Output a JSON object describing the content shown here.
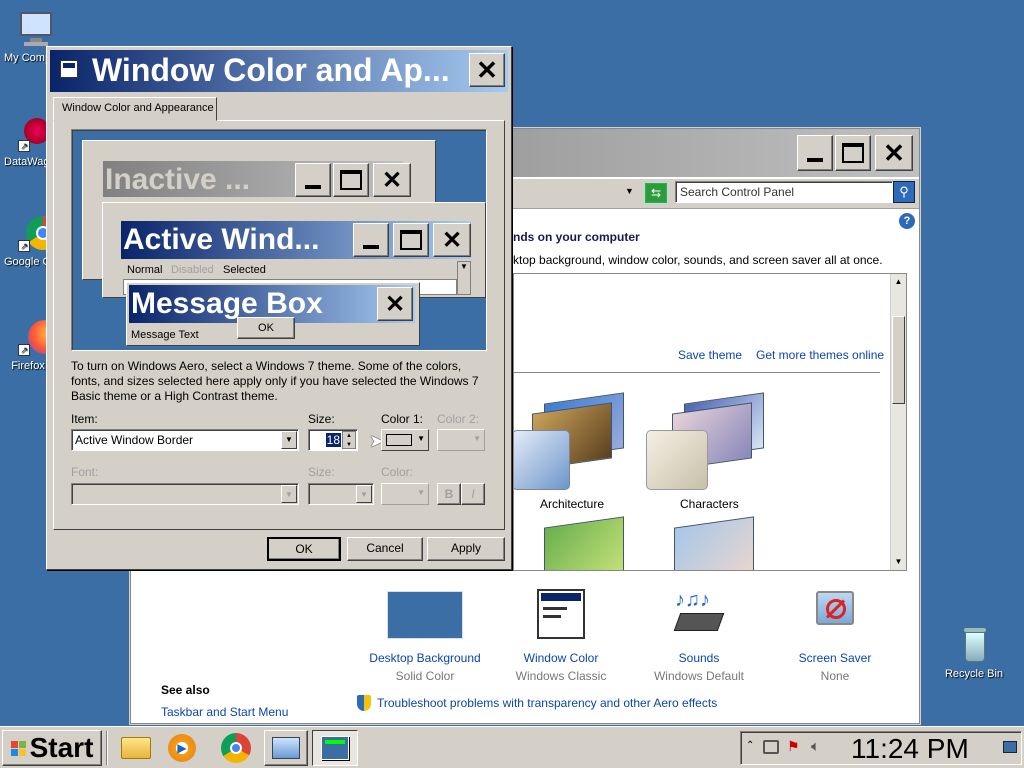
{
  "desktop": {
    "icons": [
      {
        "label": "My Computer"
      },
      {
        "label": "DataWagon"
      },
      {
        "label": "Google Chrome"
      },
      {
        "label": "Firefox"
      },
      {
        "label": "Recycle Bin"
      }
    ]
  },
  "control_panel": {
    "search_placeholder": "Search Control Panel",
    "heading": "nds on your computer",
    "subheading": "ktop background, window color, sounds, and screen saver all at once.",
    "save_theme": "Save theme",
    "more_themes": "Get more themes online",
    "themes": [
      {
        "label": "Architecture"
      },
      {
        "label": "Characters"
      }
    ],
    "bottom_items": [
      {
        "title": "Desktop Background",
        "sub": "Solid Color"
      },
      {
        "title": "Window Color",
        "sub": "Windows Classic"
      },
      {
        "title": "Sounds",
        "sub": "Windows Default"
      },
      {
        "title": "Screen Saver",
        "sub": "None"
      }
    ],
    "see_also": "See also",
    "taskbar_link": "Taskbar and Start Menu",
    "troubleshoot": "Troubleshoot problems with transparency and other Aero effects"
  },
  "dialog": {
    "title": "Window Color and Ap...",
    "tab": "Window Color and Appearance",
    "preview": {
      "inactive": "Inactive ...",
      "active": "Active Wind...",
      "menu": [
        "Normal",
        "Disabled",
        "Selected"
      ],
      "message_box": "Message Box",
      "message_text": "Message Text",
      "ok": "OK"
    },
    "description": "To turn on Windows Aero, select a Windows 7 theme.  Some of the colors, fonts, and sizes selected here apply only if you have selected the Windows 7 Basic theme or a High Contrast theme.",
    "item_label": "Item:",
    "item_value": "Active Window Border",
    "size_label": "Size:",
    "size_value": "18",
    "color1_label": "Color 1:",
    "color2_label": "Color 2:",
    "font_label": "Font:",
    "font_size_label": "Size:",
    "font_color_label": "Color:",
    "bold": "B",
    "italic": "I",
    "ok": "OK",
    "cancel": "Cancel",
    "apply": "Apply"
  },
  "taskbar": {
    "start": "Start",
    "clock": "11:24 PM"
  },
  "colors": {
    "desktop": "#3a6ea5",
    "active_caption": "#0a246a",
    "face": "#d4d0c8"
  }
}
